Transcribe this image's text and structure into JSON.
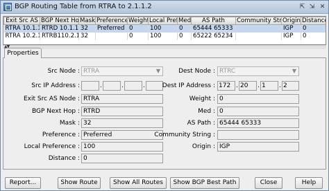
{
  "window": {
    "title": "BGP Routing Table from RTRA to 2.1.1.2",
    "restore_icon": "⇱",
    "minimize_icon": "⇲",
    "close_icon": "✕"
  },
  "table": {
    "columns": [
      "Exit Src AS",
      "BGP Next Hop",
      "Mask",
      "Preference",
      "Weight",
      "Local Pref",
      "Med",
      "AS Path",
      "Community String",
      "Origin",
      "Distance"
    ],
    "rows": [
      [
        "RTRA 10.1.1...",
        "RTRD  10.1.1.1",
        "32",
        "Preferred",
        "0",
        "100",
        "0",
        "65444 65333",
        "",
        "IGP",
        "0"
      ],
      [
        "RTRA 10.2.1...",
        "RTRB110.2.1.2",
        "32",
        "",
        "0",
        "100",
        "0",
        "65222 65234",
        "",
        "IGP",
        "0"
      ]
    ]
  },
  "splitter_arrows": "▲▼",
  "tab": {
    "label": "Properties"
  },
  "properties": {
    "src_node_label": "Src Node :",
    "src_node_value": "RTRA",
    "dest_node_label": "Dest Node :",
    "dest_node_value": "RTRC",
    "src_ip_label": "Src IP Address :",
    "src_ip": [
      "",
      "",
      "",
      ""
    ],
    "dest_ip_label": "Dest IP Address :",
    "dest_ip": [
      "172",
      "20",
      "1",
      "2"
    ],
    "exit_src_as_label": "Exit Src AS Node :",
    "exit_src_as": "RTRA",
    "weight_label": "Weight :",
    "weight": "0",
    "bgp_next_hop_label": "BGP Next Hop :",
    "bgp_next_hop": "RTRD",
    "med_label": "Med :",
    "med": "0",
    "mask_label": "Mask :",
    "mask": "32",
    "as_path_label": "AS Path :",
    "as_path": "65444 65333",
    "preference_label": "Preference :",
    "preference": "Preferred",
    "community_label": "Community String :",
    "community": "",
    "local_pref_label": "Local Preference :",
    "local_pref": "100",
    "origin_label": "Origin :",
    "origin": "IGP",
    "distance_label": "Distance :",
    "distance": "0"
  },
  "buttons": {
    "report": "Report...",
    "show_route": "Show Route",
    "show_all_routes": "Show All Routes",
    "show_bgp_best_path": "Show BGP Best Path",
    "close": "Close",
    "help": "Help"
  }
}
